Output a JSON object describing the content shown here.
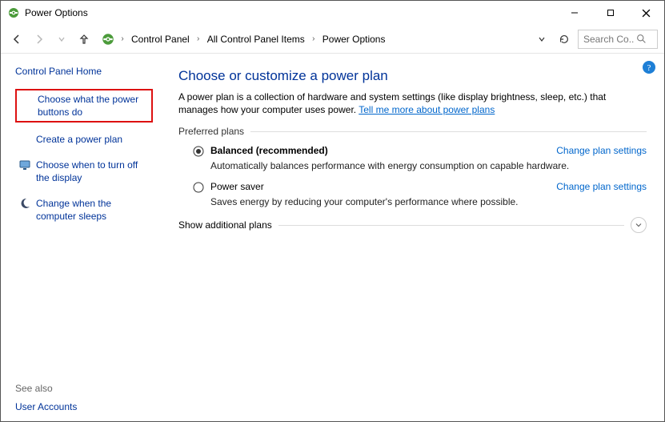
{
  "window": {
    "title": "Power Options"
  },
  "titlebar_buttons": {
    "min": "minimize",
    "max": "maximize",
    "close": "close"
  },
  "breadcrumb": {
    "items": [
      "Control Panel",
      "All Control Panel Items",
      "Power Options"
    ]
  },
  "search": {
    "placeholder": "Search Co..."
  },
  "sidebar": {
    "home": "Control Panel Home",
    "items": [
      {
        "label": "Choose what the power buttons do",
        "highlighted": true,
        "icon": null
      },
      {
        "label": "Create a power plan",
        "icon": null
      },
      {
        "label": "Choose when to turn off the display",
        "icon": "monitor"
      },
      {
        "label": "Change when the computer sleeps",
        "icon": "moon"
      }
    ],
    "see_also_label": "See also",
    "see_also_items": [
      "User Accounts"
    ]
  },
  "main": {
    "heading": "Choose or customize a power plan",
    "description_pre": "A power plan is a collection of hardware and system settings (like display brightness, sleep, etc.) that manages how your computer uses power. ",
    "description_link": "Tell me more about power plans",
    "preferred_plans_label": "Preferred plans",
    "plans": [
      {
        "name": "Balanced (recommended)",
        "selected": true,
        "desc": "Automatically balances performance with energy consumption on capable hardware.",
        "change_label": "Change plan settings"
      },
      {
        "name": "Power saver",
        "selected": false,
        "desc": "Saves energy by reducing your computer's performance where possible.",
        "change_label": "Change plan settings"
      }
    ],
    "show_additional_label": "Show additional plans"
  }
}
